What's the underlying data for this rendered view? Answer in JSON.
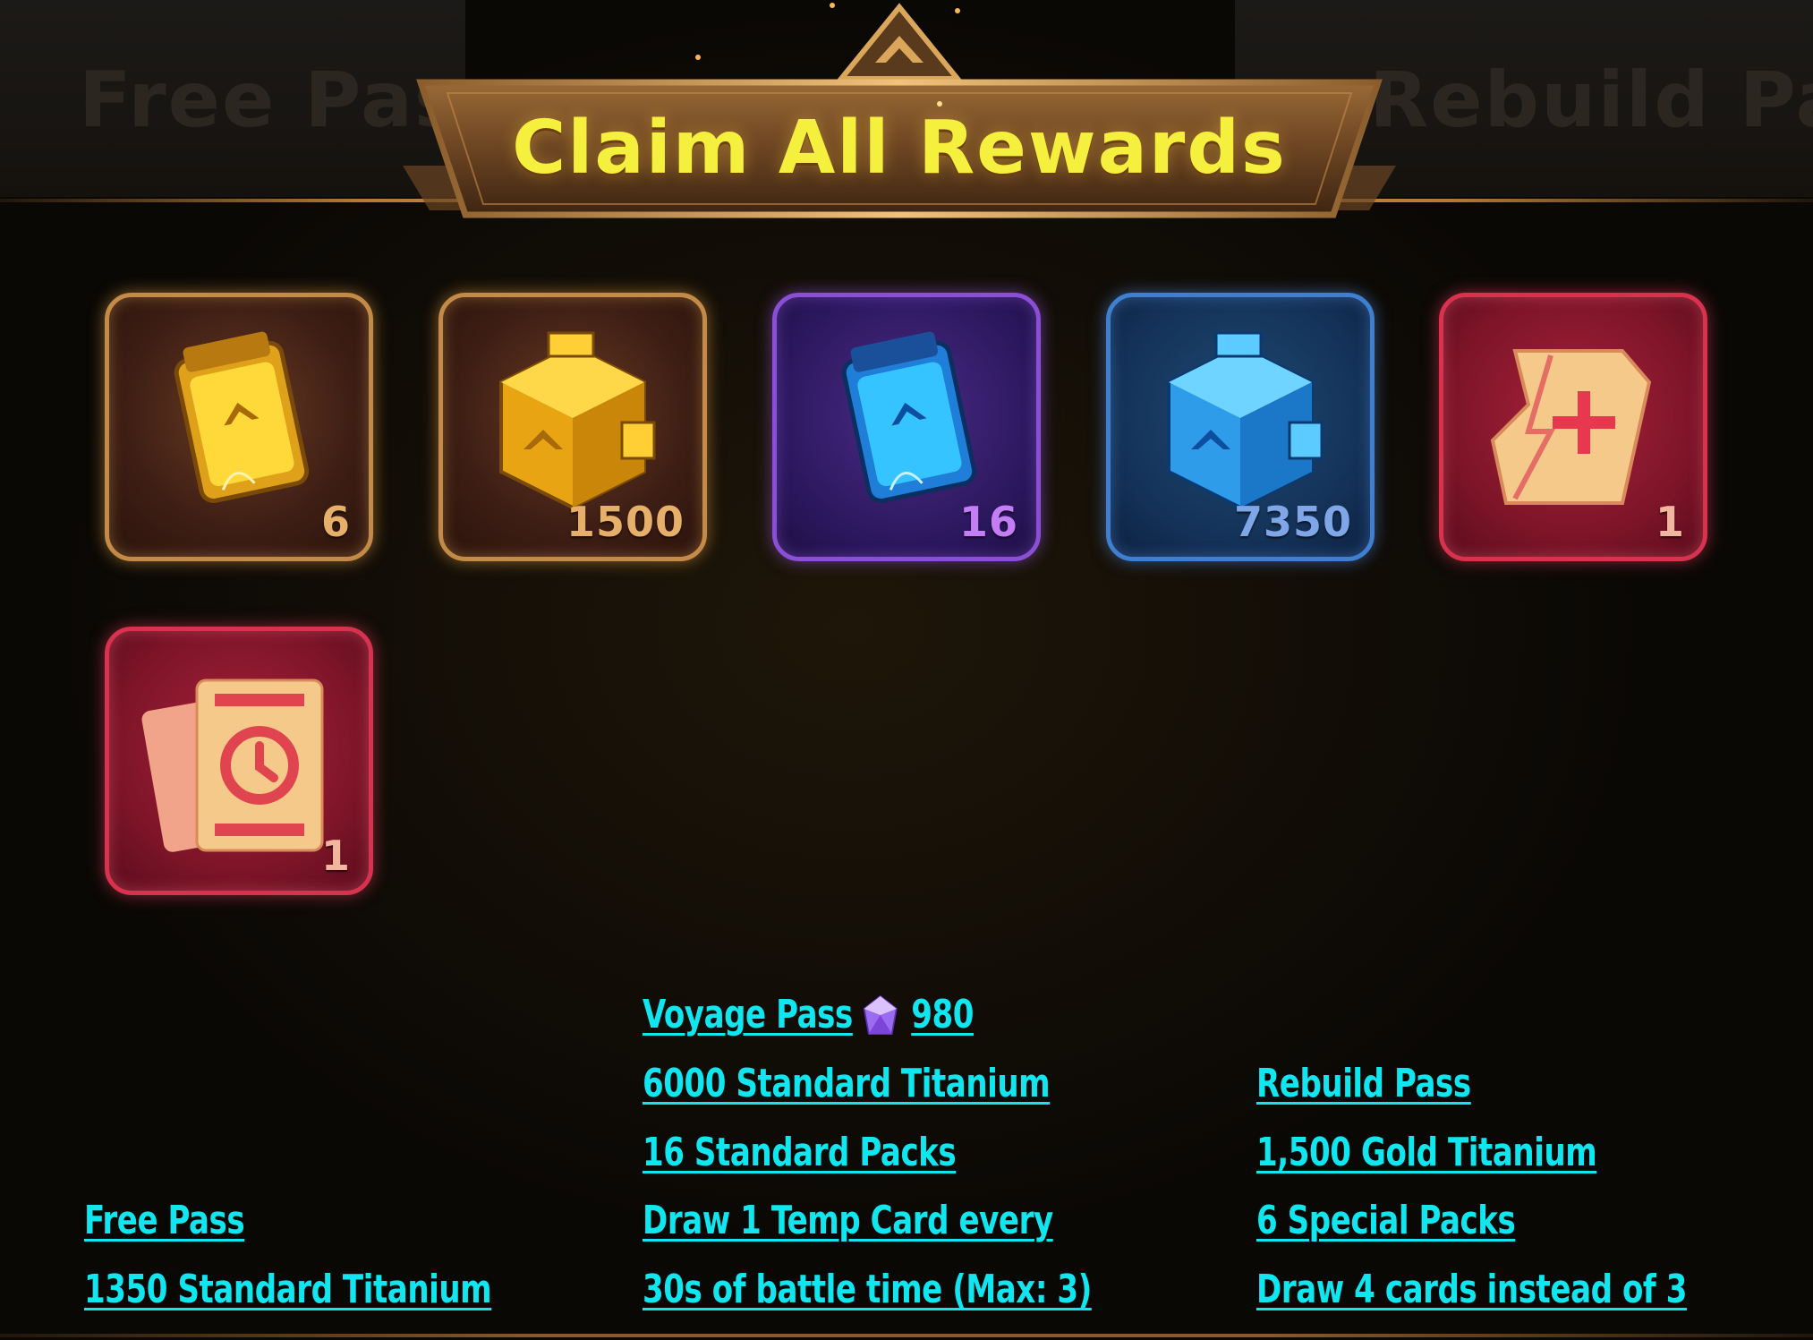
{
  "background_tabs": {
    "left": "Free Pass",
    "right": "Rebuild Pass"
  },
  "banner": {
    "title": "Claim All Rewards"
  },
  "rewards": [
    {
      "name": "special-pack",
      "count": "6",
      "count_color": "#e7b06a"
    },
    {
      "name": "gold-titanium",
      "count": "1500",
      "count_color": "#e7b06a"
    },
    {
      "name": "standard-pack",
      "count": "16",
      "count_color": "#c47ef5"
    },
    {
      "name": "standard-titanium",
      "count": "7350",
      "count_color": "#7fa6e6"
    },
    {
      "name": "rebuild-ticket",
      "count": "1",
      "count_color": "#f2b69e"
    },
    {
      "name": "temp-card-ticket",
      "count": "1",
      "count_color": "#f2b69e"
    }
  ],
  "captions": {
    "free_pass": {
      "title": "Free Pass",
      "line1": "1350 Standard Titanium"
    },
    "voyage_pass": {
      "title": "Voyage Pass",
      "price": "980",
      "line1": "6000 Standard Titanium",
      "line2": "16 Standard Packs",
      "line3": "Draw 1 Temp Card every",
      "line4": "30s of battle time (Max: 3)"
    },
    "rebuild_pass": {
      "title": "Rebuild Pass",
      "line1": "1,500 Gold Titanium",
      "line2": "6 Special Packs",
      "line3": "Draw 4 cards instead of 3"
    }
  },
  "colors": {
    "caption": "#10e6ef",
    "banner_title": "#f5ef3d",
    "gem": "#9b6cf0"
  }
}
